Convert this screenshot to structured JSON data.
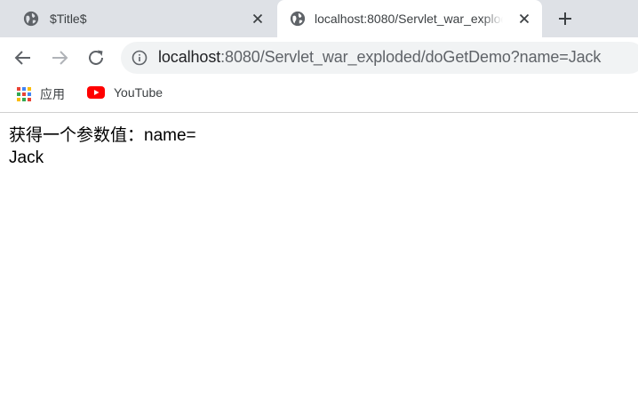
{
  "tabs": [
    {
      "title": "$Title$",
      "active": false
    },
    {
      "title": "localhost:8080/Servlet_war_exploded/doGetDemo?name=Jack",
      "active": true
    }
  ],
  "toolbar": {
    "url_host": "localhost",
    "url_rest": ":8080/Servlet_war_exploded/doGetDemo?name=Jack"
  },
  "bookmarks": [
    {
      "label": "应用",
      "icon": "apps-grid-icon"
    },
    {
      "label": "YouTube",
      "icon": "youtube-icon"
    }
  ],
  "content": {
    "line1": "获得一个参数值：name=",
    "line2": "Jack"
  },
  "colors": {
    "tabstrip_bg": "#dee1e6",
    "omnibox_bg": "#f1f3f4",
    "youtube_red": "#ff0000"
  }
}
